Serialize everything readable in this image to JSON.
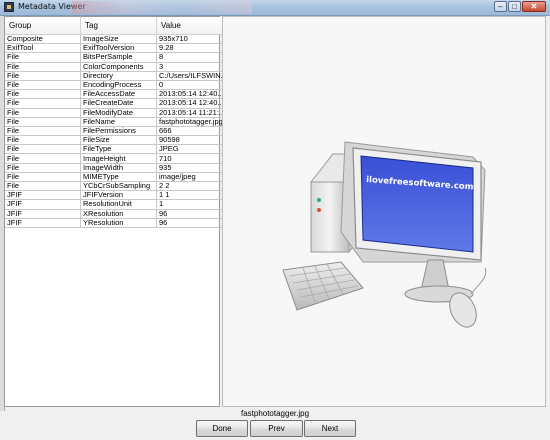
{
  "window": {
    "title": "Metadata Viewer",
    "minimize_glyph": "–",
    "maximize_glyph": "□",
    "close_glyph": "✕"
  },
  "table": {
    "headers": [
      "Group",
      "Tag",
      "Value"
    ],
    "rows": [
      [
        "Composite",
        "ImageSize",
        "935x710"
      ],
      [
        "ExifTool",
        "ExifToolVersion",
        "9.28"
      ],
      [
        "File",
        "BitsPerSample",
        "8"
      ],
      [
        "File",
        "ColorComponents",
        "3"
      ],
      [
        "File",
        "Directory",
        "C:/Users/ILFSWIN..."
      ],
      [
        "File",
        "EncodingProcess",
        "0"
      ],
      [
        "File",
        "FileAccessDate",
        "2013:05:14 12:40..."
      ],
      [
        "File",
        "FileCreateDate",
        "2013:05:14 12:40..."
      ],
      [
        "File",
        "FileModifyDate",
        "2013:05:14 11:21:..."
      ],
      [
        "File",
        "FileName",
        "fastphototagger.jpg"
      ],
      [
        "File",
        "FilePermissions",
        "666"
      ],
      [
        "File",
        "FileSize",
        "90598"
      ],
      [
        "File",
        "FileType",
        "JPEG"
      ],
      [
        "File",
        "ImageHeight",
        "710"
      ],
      [
        "File",
        "ImageWidth",
        "935"
      ],
      [
        "File",
        "MIMEType",
        "image/jpeg"
      ],
      [
        "File",
        "YCbCrSubSampling",
        "2 2"
      ],
      [
        "JFIF",
        "JFIFVersion",
        "1 1"
      ],
      [
        "JFIF",
        "ResolutionUnit",
        "1"
      ],
      [
        "JFIF",
        "XResolution",
        "96"
      ],
      [
        "JFIF",
        "YResolution",
        "96"
      ]
    ]
  },
  "preview": {
    "screen_text": "ilovefreesoftware.com",
    "icon": "computer-illustration"
  },
  "footer": {
    "file_name": "fastphototagger.jpg",
    "done_label": "Done",
    "prev_label": "Prev",
    "next_label": "Next"
  },
  "colors": {
    "title_bar": "#a9c3df",
    "screen_blue": "#2f44c8",
    "close_red": "#c9462f"
  }
}
